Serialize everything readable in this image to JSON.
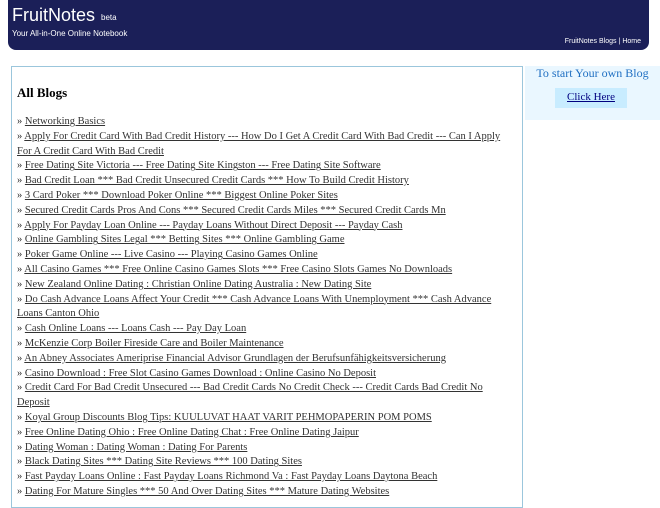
{
  "header": {
    "brand": "FruitNotes",
    "beta": "beta",
    "tagline": "Your All-in-One Online Notebook",
    "links": [
      "FruitNotes Blogs",
      "Home"
    ],
    "separator": "|"
  },
  "main": {
    "title": "All Blogs",
    "bullet": "»",
    "blogs": [
      "Networking Basics",
      "Apply For Credit Card With Bad Credit History --- How Do I Get A Credit Card With Bad Credit --- Can I Apply For A Credit Card With Bad Credit",
      "Free Dating Site Victoria --- Free Dating Site Kingston --- Free Dating Site Software",
      "Bad Credit Loan *** Bad Credit Unsecured Credit Cards *** How To Build Credit History",
      "3 Card Poker *** Download Poker Online *** Biggest Online Poker Sites",
      "Secured Credit Cards Pros And Cons *** Secured Credit Cards Miles *** Secured Credit Cards Mn",
      "Apply For Payday Loan Online --- Payday Loans Without Direct Deposit --- Payday Cash",
      "Online Gambling Sites Legal *** Betting Sites *** Online Gambling Game",
      "Poker Game Online --- Live Casino --- Playing Casino Games Online",
      "All Casino Games *** Free Online Casino Games Slots *** Free Casino Slots Games No Downloads",
      "New Zealand Online Dating : Christian Online Dating Australia : New Dating Site",
      "Do Cash Advance Loans Affect Your Credit *** Cash Advance Loans With Unemployment *** Cash Advance Loans Canton Ohio",
      "Cash Online Loans --- Loans Cash --- Pay Day Loan",
      "McKenzie Corp Boiler Fireside Care and Boiler Maintenance",
      "An Abney Associates Ameriprise Financial Advisor Grundlagen der Berufsunfähigkeitsversicherung",
      "Casino Download : Free Slot Casino Games Download : Online Casino No Deposit",
      "Credit Card For Bad Credit Unsecured --- Bad Credit Cards No Credit Check --- Credit Cards Bad Credit No Deposit",
      "Koyal Group Discounts Blog Tips: KUULUVAT HAAT VARIT PEHMOPAPERIN POM POMS",
      "Free Online Dating Ohio : Free Online Dating Chat : Free Online Dating Jaipur",
      "Dating Woman : Dating Woman : Dating For Parents",
      "Black Dating Sites *** Dating Site Reviews *** 100 Dating Sites",
      "Fast Payday Loans Online : Fast Payday Loans Richmond Va : Fast Payday Loans Daytona Beach",
      "Dating For Mature Singles *** 50 And Over Dating Sites *** Mature Dating Websites"
    ]
  },
  "sidebar": {
    "title": "To start Your own Blog",
    "button": "Click Here"
  }
}
